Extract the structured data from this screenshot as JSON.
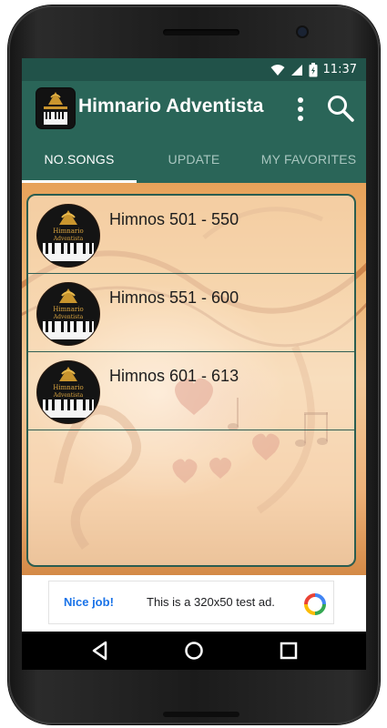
{
  "status_bar": {
    "time": "11:37",
    "icons": [
      "wifi-icon",
      "signal-icon",
      "battery-icon"
    ]
  },
  "app_bar": {
    "title": "Himnario Adventista",
    "icon": "app-logo",
    "actions": [
      "overflow-menu-icon",
      "search-icon"
    ]
  },
  "tabs": [
    {
      "label": "NO.SONGS",
      "active": true
    },
    {
      "label": "UPDATE",
      "active": false
    },
    {
      "label": "MY FAVORITES",
      "active": false
    }
  ],
  "list": {
    "items": [
      {
        "label": "Himnos 501 - 550"
      },
      {
        "label": "Himnos 551 - 600"
      },
      {
        "label": "Himnos 601 - 613"
      }
    ],
    "avatar_logo_text_line1": "Himnario",
    "avatar_logo_text_line2": "Adventista"
  },
  "ad": {
    "badge": "Nice job!",
    "text": "This is a 320x50 test ad."
  },
  "navigation": [
    "back-icon",
    "home-icon",
    "recents-icon"
  ],
  "colors": {
    "status_bar": "#215249",
    "app_bar": "#2a6558",
    "tab_inactive": "#a8c6bf",
    "list_border": "#2a5d50",
    "ad_accent": "#1a73e8"
  }
}
